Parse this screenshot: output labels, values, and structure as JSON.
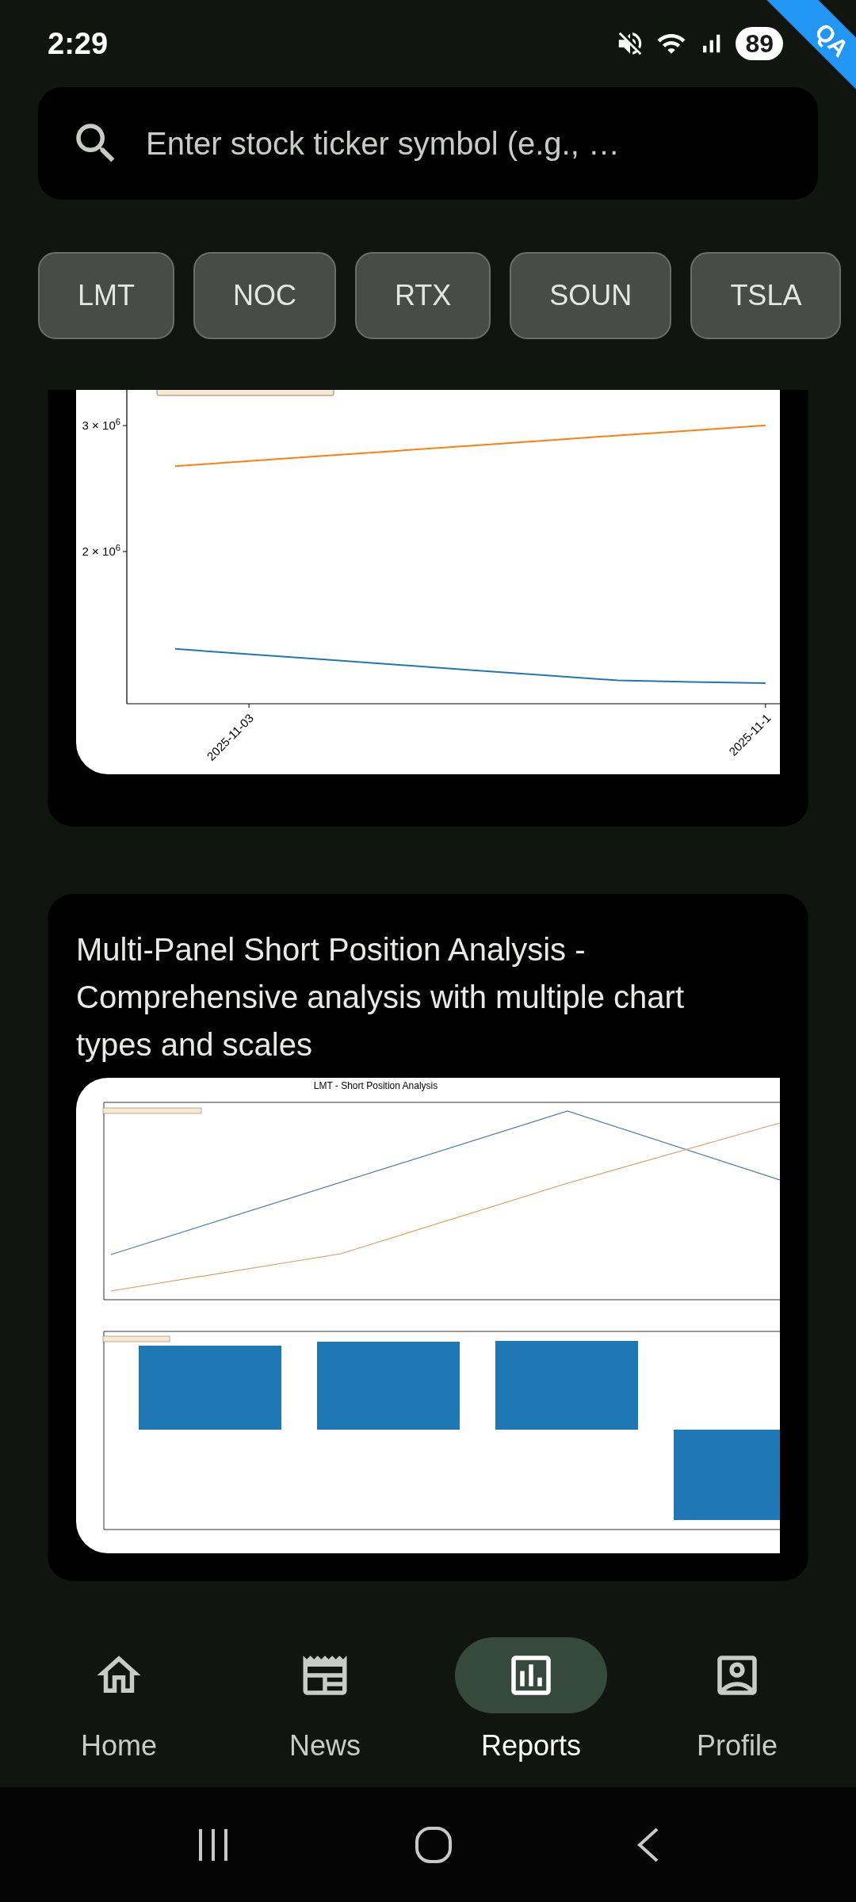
{
  "status_bar": {
    "time": "2:29",
    "battery": "89"
  },
  "debug_banner": "QA",
  "search": {
    "placeholder": "Enter stock ticker symbol (e.g., …"
  },
  "chips": [
    "LMT",
    "NOC",
    "RTX",
    "SOUN",
    "TSLA"
  ],
  "cards": [
    {
      "kind": "chart",
      "chart_data": {
        "type": "line",
        "categories": [
          null,
          "2025-11-03",
          null,
          null,
          null,
          null,
          null,
          null,
          "2025-11-1"
        ],
        "series": [
          {
            "color": "#1f77b4",
            "values": [
              1227000,
              1185000,
              1144000,
              1102000,
              1060000,
              1019000,
              977000,
              965000,
              955000
            ]
          },
          {
            "color": "#ff7f0e",
            "values": [
              2678000,
              2718000,
              2759000,
              2799000,
              2840000,
              2880000,
              2921000,
              2961000,
              3002000
            ]
          }
        ],
        "ylim": [
          792000,
          3283000
        ],
        "yticks": [
          {
            "value": 2000000,
            "label": "2 × 10$^{6}$"
          },
          {
            "value": 3000000,
            "label": "3 × 10$^{6}$"
          }
        ]
      }
    },
    {
      "kind": "figure",
      "title": "Multi-Panel Short Position Analysis - Comprehensive analysis with multiple chart types and scales",
      "figure_title": "LMT - Short Position Analysis"
    }
  ],
  "nav": [
    {
      "label": "Home",
      "selected": false
    },
    {
      "label": "News",
      "selected": false
    },
    {
      "label": "Reports",
      "selected": true
    },
    {
      "label": "Profile",
      "selected": false
    }
  ]
}
